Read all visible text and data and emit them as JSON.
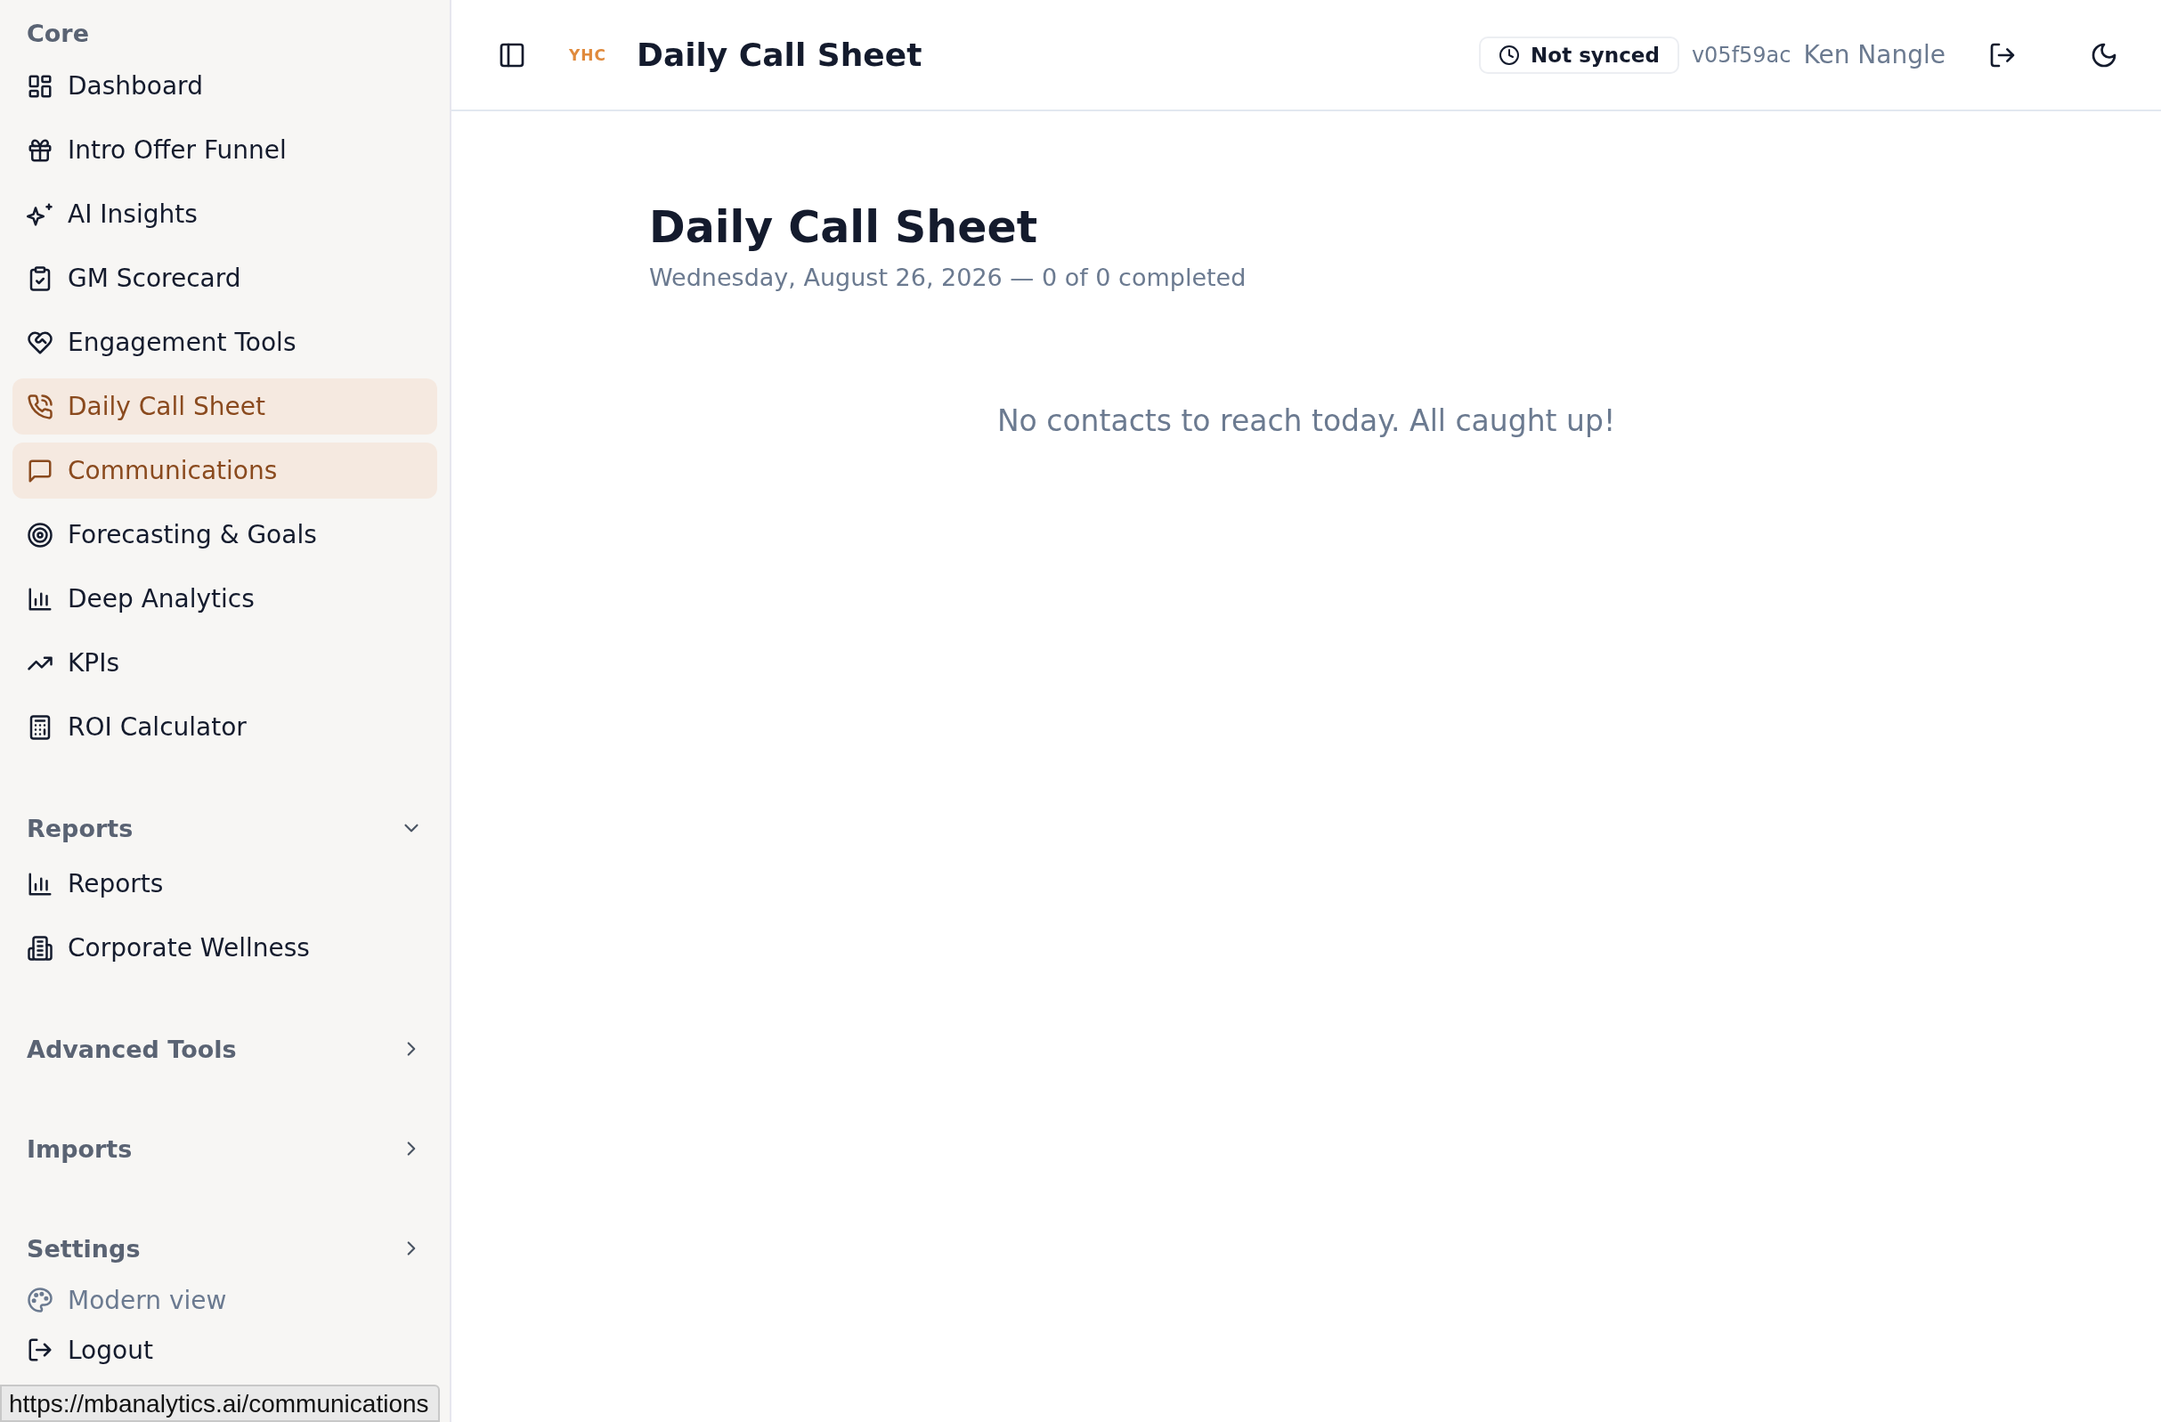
{
  "sidebar": {
    "groups": [
      {
        "label": "Core",
        "items": [
          {
            "label": "Dashboard",
            "selected": false
          },
          {
            "label": "Intro Offer Funnel",
            "selected": false
          },
          {
            "label": "AI Insights",
            "selected": false
          },
          {
            "label": "GM Scorecard",
            "selected": false
          },
          {
            "label": "Engagement Tools",
            "selected": false
          },
          {
            "label": "Daily Call Sheet",
            "selected": true
          },
          {
            "label": "Communications",
            "selected": true
          },
          {
            "label": "Forecasting & Goals",
            "selected": false
          },
          {
            "label": "Deep Analytics",
            "selected": false
          },
          {
            "label": "KPIs",
            "selected": false
          },
          {
            "label": "ROI Calculator",
            "selected": false
          }
        ]
      },
      {
        "label": "Reports",
        "expanded": true,
        "items": [
          {
            "label": "Reports",
            "selected": false
          },
          {
            "label": "Corporate Wellness",
            "selected": false
          }
        ]
      },
      {
        "label": "Advanced Tools",
        "expanded": false
      },
      {
        "label": "Imports",
        "expanded": false
      },
      {
        "label": "Settings",
        "expanded": false
      }
    ],
    "footer": [
      {
        "label": "Modern view",
        "kind": "muted"
      },
      {
        "label": "Logout",
        "kind": "normal"
      }
    ]
  },
  "header": {
    "logo": "YHC",
    "title": "Daily Call Sheet",
    "sync_status": "Not synced",
    "version": "v05f59ac",
    "user": "Ken Nangle"
  },
  "page": {
    "title": "Daily Call Sheet",
    "subtitle": "Wednesday, August 26, 2026 — 0 of 0 completed",
    "empty_message": "No contacts to reach today. All caught up!"
  },
  "status_bar": {
    "url": "https://mbanalytics.ai/communications"
  }
}
